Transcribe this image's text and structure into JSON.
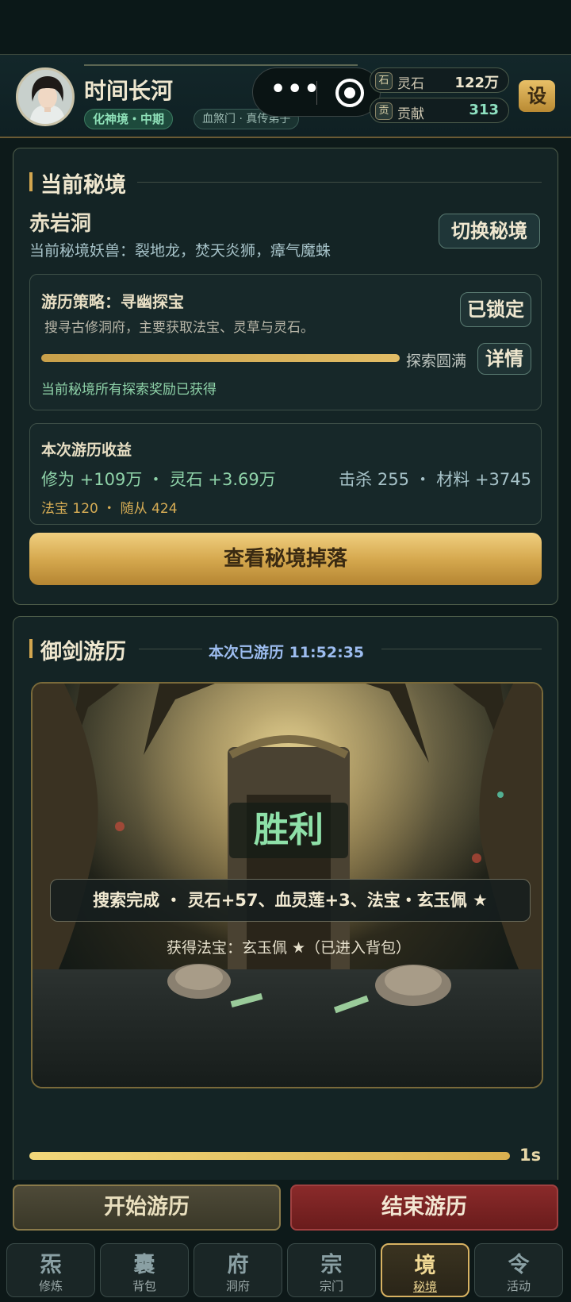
{
  "colors": {
    "accent_gold": "#d3a64f",
    "accent_green": "#8fd3a9",
    "danger_red": "#8a2a2a",
    "panel_bg": "#142425"
  },
  "header": {
    "player_name": "时间长河",
    "realm": "化神境・中期",
    "sect": "血煞门 · 真传弟子",
    "capsule_menu_icon": "more-dots-icon",
    "capsule_close_icon": "target-icon",
    "resources": [
      {
        "icon_text": "石",
        "label": "灵石",
        "value": "122万",
        "color": "#efe7cf"
      },
      {
        "icon_text": "贡",
        "label": "贡献",
        "value": "313",
        "color": "#8ee0c0"
      }
    ],
    "settings_label": "设"
  },
  "realm_panel": {
    "title": "当前秘境",
    "realm_name": "赤岩洞",
    "monsters": "当前秘境妖兽：裂地龙，焚天炎狮，瘴气魔蛛",
    "switch_label": "切换秘境",
    "strategy": {
      "title": "游历策略：寻幽探宝",
      "desc": "搜寻古修洞府，主要获取法宝、灵草与灵石。",
      "lock_label": "已锁定",
      "progress_fraction": 1.0,
      "progress_text": "探索圆满",
      "detail_label": "详情",
      "reward_note": "当前秘境所有探索奖励已获得"
    },
    "earnings": {
      "title": "本次游历收益",
      "line1_left": "修为 +109万 ・ 灵石 +3.69万",
      "line1_right": "击杀 255 ・ 材料 +3745",
      "line2": "法宝 120 ・ 随从 424"
    },
    "drops_label": "查看秘境掉落"
  },
  "travel_panel": {
    "title": "御剑游历",
    "elapsed": "本次已游历 11:52:35",
    "victory": "胜利",
    "result": "搜索完成 ・ 灵石+57、血灵莲+3、法宝・玄玉佩 ★",
    "result_sub": "获得法宝：玄玉佩 ★（已进入背包）",
    "timer_fraction": 1.0,
    "timer_label": "1s"
  },
  "actions": {
    "start_label": "开始游历",
    "end_label": "结束游历"
  },
  "tabs": [
    {
      "glyph": "炁",
      "label": "修炼",
      "active": false
    },
    {
      "glyph": "囊",
      "label": "背包",
      "active": false
    },
    {
      "glyph": "府",
      "label": "洞府",
      "active": false
    },
    {
      "glyph": "宗",
      "label": "宗门",
      "active": false
    },
    {
      "glyph": "境",
      "label": "秘境",
      "active": true
    },
    {
      "glyph": "令",
      "label": "活动",
      "active": false
    }
  ]
}
